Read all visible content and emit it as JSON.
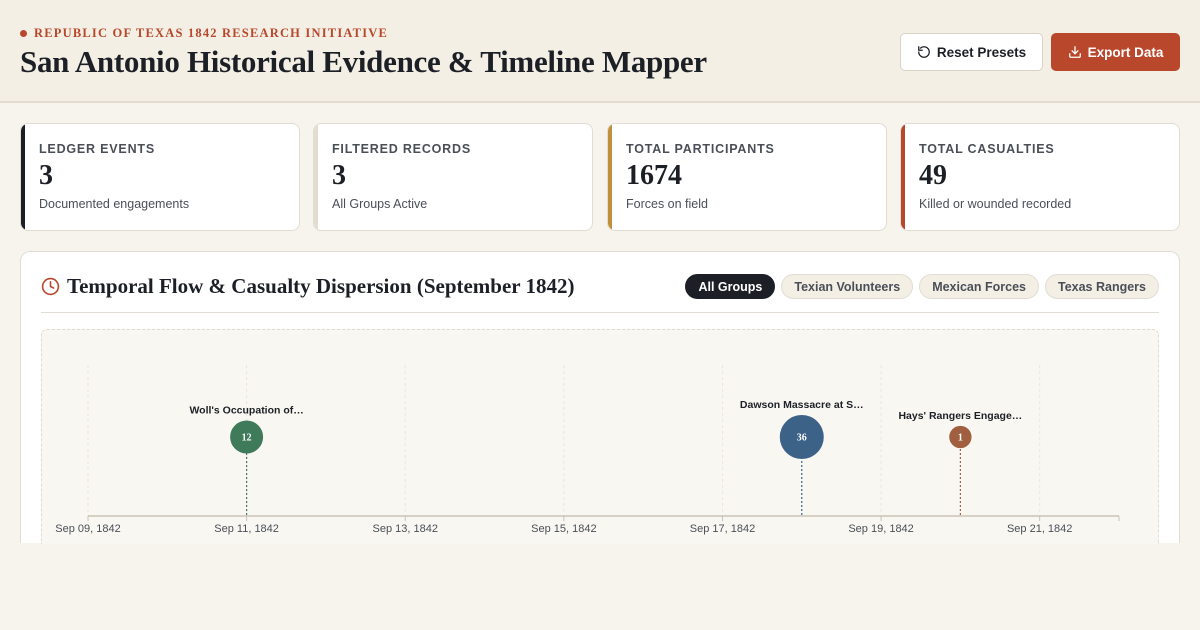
{
  "header": {
    "eyebrow": "REPUBLIC OF TEXAS 1842 RESEARCH INITIATIVE",
    "title": "San Antonio Historical Evidence & Timeline Mapper",
    "reset_label": "Reset Presets",
    "export_label": "Export Data"
  },
  "stats": [
    {
      "label": "LEDGER EVENTS",
      "value": "3",
      "sub": "Documented engagements",
      "accent": "#1c2026"
    },
    {
      "label": "FILTERED RECORDS",
      "value": "3",
      "sub": "All Groups Active",
      "accent": "#e4ddcf"
    },
    {
      "label": "TOTAL PARTICIPANTS",
      "value": "1674",
      "sub": "Forces on field",
      "accent": "#c0913c"
    },
    {
      "label": "TOTAL CASUALTIES",
      "value": "49",
      "sub": "Killed or wounded recorded",
      "accent": "#b8472b"
    }
  ],
  "panel": {
    "title": "Temporal Flow & Casualty Dispersion (September 1842)",
    "filters": [
      {
        "label": "All Groups",
        "active": true
      },
      {
        "label": "Texian Volunteers",
        "active": false
      },
      {
        "label": "Mexican Forces",
        "active": false
      },
      {
        "label": "Texas Rangers",
        "active": false
      }
    ]
  },
  "colors": {
    "accent": "#b8472b",
    "ink": "#1c2026"
  },
  "chart_data": {
    "type": "scatter",
    "x_ticks": [
      "Sep 09, 1842",
      "Sep 11, 1842",
      "Sep 13, 1842",
      "Sep 15, 1842",
      "Sep 17, 1842",
      "Sep 19, 1842",
      "Sep 21, 1842"
    ],
    "x_range": [
      "1842-09-09",
      "1842-09-22"
    ],
    "events": [
      {
        "date": "1842-09-11",
        "label": "Woll's Occupation of…",
        "casualties": 12,
        "color": "#3f7a5a"
      },
      {
        "date": "1842-09-18",
        "label": "Dawson Massacre at S…",
        "casualties": 36,
        "color": "#3c6288"
      },
      {
        "date": "1842-09-20",
        "label": "Hays' Rangers Engage…",
        "casualties": 1,
        "color": "#a0603f"
      }
    ]
  }
}
